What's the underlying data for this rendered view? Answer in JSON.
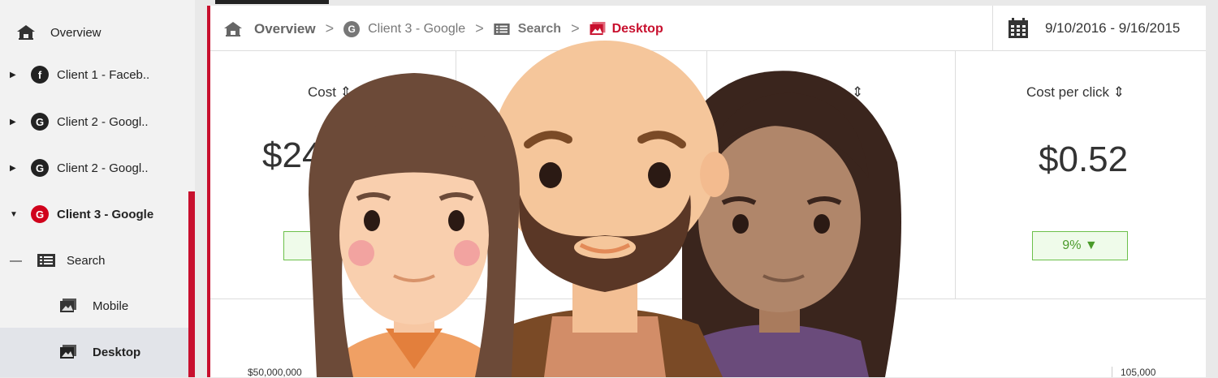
{
  "sidebar": {
    "items": [
      {
        "label": "Overview",
        "icon": "house-icon"
      },
      {
        "label": "Client 1 - Faceb..",
        "icon": "facebook-icon",
        "glyph": "f"
      },
      {
        "label": "Client 2 - Googl..",
        "icon": "google-icon",
        "glyph": "G"
      },
      {
        "label": "Client 2 - Googl..",
        "icon": "google-icon",
        "glyph": "G"
      },
      {
        "label": "Client 3 - Google",
        "icon": "google-icon",
        "glyph": "G"
      },
      {
        "label": "Search",
        "icon": "list-icon"
      },
      {
        "label": "Mobile",
        "icon": "image-icon"
      },
      {
        "label": "Desktop",
        "icon": "image-icon"
      }
    ],
    "collapse_dash": "—"
  },
  "breadcrumb": {
    "overview": "Overview",
    "client": "Client 3 - Google",
    "search": "Search",
    "desktop": "Desktop",
    "sep": ">",
    "g_glyph": "G"
  },
  "date_range": "9/10/2016 - 9/16/2015",
  "metrics": [
    {
      "label": "Cost",
      "value": "$24",
      "sort": "⇕"
    },
    {
      "label": "",
      "value": "",
      "sort": "⇕"
    },
    {
      "label": "Cost per click",
      "value": "$0.52",
      "sort": "⇕",
      "change": "9% ▼"
    }
  ],
  "chart": {
    "left_axis_top": "$50,000,000",
    "right_axis_top": "105,000"
  },
  "colors": {
    "accent": "#c8102e",
    "positive": "#6cc04a"
  }
}
